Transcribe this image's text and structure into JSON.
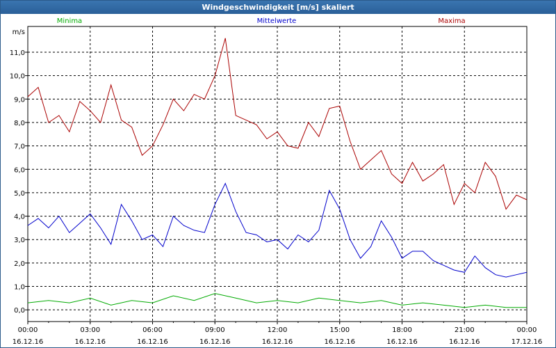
{
  "window": {
    "title": "Windgeschwindigkeit [m/s] skaliert"
  },
  "chart_data": {
    "type": "line",
    "ylabel": "m/s",
    "ylim": [
      -0.5,
      12.1
    ],
    "y_ticks": [
      "0,0",
      "1,0",
      "2,0",
      "3,0",
      "4,0",
      "5,0",
      "6,0",
      "7,0",
      "8,0",
      "9,0",
      "10,0",
      "11,0"
    ],
    "x_ticks": [
      {
        "time": "00:00",
        "date": "16.12.16"
      },
      {
        "time": "03:00",
        "date": "16.12.16"
      },
      {
        "time": "06:00",
        "date": "16.12.16"
      },
      {
        "time": "09:00",
        "date": "16.12.16"
      },
      {
        "time": "12:00",
        "date": "16.12.16"
      },
      {
        "time": "15:00",
        "date": "16.12.16"
      },
      {
        "time": "18:00",
        "date": "16.12.16"
      },
      {
        "time": "21:00",
        "date": "16.12.16"
      },
      {
        "time": "00:00",
        "date": "17.12.16"
      }
    ],
    "x_range_hours": [
      0,
      24
    ],
    "grid": true,
    "legend_position": "top",
    "series": [
      {
        "name": "Minima",
        "color": "#00aa00",
        "x": [
          0,
          1,
          2,
          3,
          4,
          5,
          6,
          7,
          8,
          9,
          10,
          11,
          12,
          13,
          14,
          15,
          16,
          17,
          18,
          19,
          20,
          21,
          22,
          23,
          24
        ],
        "values": [
          0.3,
          0.4,
          0.3,
          0.5,
          0.2,
          0.4,
          0.3,
          0.6,
          0.4,
          0.7,
          0.5,
          0.3,
          0.4,
          0.3,
          0.5,
          0.4,
          0.3,
          0.4,
          0.2,
          0.3,
          0.2,
          0.1,
          0.2,
          0.1,
          0.1
        ]
      },
      {
        "name": "Mittelwerte",
        "color": "#0000cc",
        "x": [
          0,
          0.5,
          1,
          1.5,
          2,
          2.5,
          3,
          3.5,
          4,
          4.5,
          5,
          5.5,
          6,
          6.5,
          7,
          7.5,
          8,
          8.5,
          9,
          9.5,
          10,
          10.5,
          11,
          11.5,
          12,
          12.5,
          13,
          13.5,
          14,
          14.5,
          15,
          15.5,
          16,
          16.5,
          17,
          17.5,
          18,
          18.5,
          19,
          19.5,
          20,
          20.5,
          21,
          21.5,
          22,
          22.5,
          23,
          23.5,
          24
        ],
        "values": [
          3.6,
          3.9,
          3.5,
          4.0,
          3.3,
          3.7,
          4.1,
          3.5,
          2.8,
          4.5,
          3.8,
          3.0,
          3.2,
          2.7,
          4.0,
          3.6,
          3.4,
          3.3,
          4.5,
          5.4,
          4.2,
          3.3,
          3.2,
          2.9,
          3.0,
          2.6,
          3.2,
          2.9,
          3.4,
          5.1,
          4.3,
          3.0,
          2.2,
          2.7,
          3.8,
          3.1,
          2.2,
          2.5,
          2.5,
          2.1,
          1.9,
          1.7,
          1.6,
          2.3,
          1.8,
          1.5,
          1.4,
          1.5,
          1.6
        ]
      },
      {
        "name": "Maxima",
        "color": "#aa0000",
        "x": [
          0,
          0.5,
          1,
          1.5,
          2,
          2.5,
          3,
          3.5,
          4,
          4.5,
          5,
          5.5,
          6,
          6.5,
          7,
          7.5,
          8,
          8.5,
          9,
          9.5,
          10,
          10.5,
          11,
          11.5,
          12,
          12.5,
          13,
          13.5,
          14,
          14.5,
          15,
          15.5,
          16,
          16.5,
          17,
          17.5,
          18,
          18.5,
          19,
          19.5,
          20,
          20.5,
          21,
          21.5,
          22,
          22.5,
          23,
          23.5,
          24
        ],
        "values": [
          9.1,
          9.5,
          8.0,
          8.3,
          7.6,
          8.9,
          8.5,
          8.0,
          9.6,
          8.1,
          7.8,
          6.6,
          7.0,
          7.9,
          9.0,
          8.5,
          9.2,
          9.0,
          10.0,
          11.6,
          8.3,
          8.1,
          7.9,
          7.3,
          7.6,
          7.0,
          6.9,
          8.0,
          7.4,
          8.6,
          8.7,
          7.2,
          6.0,
          6.4,
          6.8,
          5.8,
          5.4,
          6.3,
          5.5,
          5.8,
          6.2,
          4.5,
          5.4,
          5.0,
          6.3,
          5.7,
          4.3,
          4.9,
          4.7
        ]
      }
    ]
  }
}
